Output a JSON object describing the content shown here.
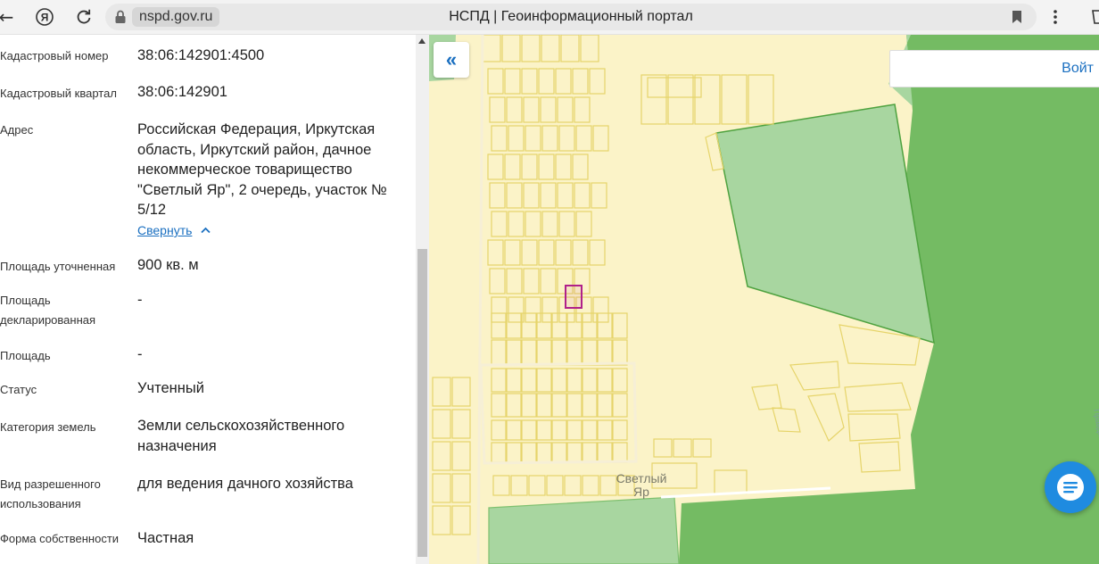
{
  "browser": {
    "domain": "nspd.gov.ru",
    "page_title": "НСПД | Геоинформационный портал",
    "icons": [
      "back-icon",
      "yandex-icon",
      "reload-icon",
      "lock-icon",
      "bookmark-icon",
      "menu-icon"
    ]
  },
  "details": {
    "cadastral_number": {
      "label": "Кадастровый номер",
      "value": "38:06:142901:4500"
    },
    "cadastral_quarter": {
      "label": "Кадастровый квартал",
      "value": "38:06:142901"
    },
    "address": {
      "label": "Адрес",
      "value": "Российская Федерация, Иркутская область, Иркутский район, дачное некоммерческое товарищество \"Светлый Яр\", 2 очередь, участок № 5/12",
      "collapse_label": "Свернуть"
    },
    "area_specified": {
      "label": "Площадь уточненная",
      "value": "900 кв. м"
    },
    "area_declared": {
      "label": "Площадь декларированная",
      "value": "-"
    },
    "area": {
      "label": "Площадь",
      "value": "-"
    },
    "status": {
      "label": "Статус",
      "value": "Учтенный"
    },
    "land_category": {
      "label": "Категория земель",
      "value": "Земли сельскохозяйственного назначения"
    },
    "permitted_use": {
      "label": "Вид разрешенного использования",
      "value": "для ведения дачного хозяйства"
    },
    "ownership": {
      "label": "Форма собственности",
      "value": "Частная"
    }
  },
  "map": {
    "collapse_button": "«",
    "login_label": "Войт",
    "place_label": "Светлый Яр",
    "colors": {
      "background": "#fbf3c8",
      "parcel_stroke": "#e6d46a",
      "forest": "#74bb63",
      "selected": "#b0208a",
      "accent": "#1a6fc0"
    }
  }
}
